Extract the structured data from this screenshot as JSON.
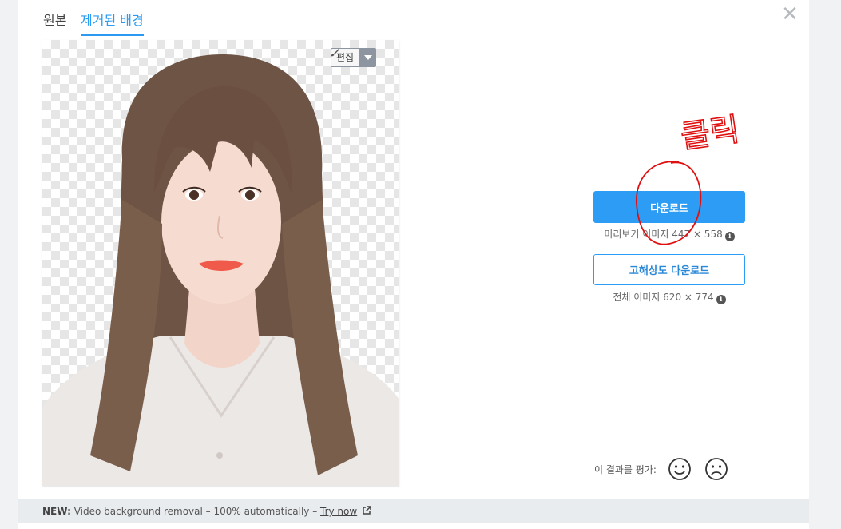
{
  "tabs": [
    {
      "label": "원본",
      "active": false
    },
    {
      "label": "제거된 배경",
      "active": true
    }
  ],
  "close_icon": "close-x-icon",
  "preview": {
    "edit_label": "편집",
    "edit_icon": "brush-icon",
    "caret_icon": "caret-down-icon"
  },
  "download": {
    "label": "다운로드",
    "info_prefix": "미리보기 이미지",
    "info_size": "447 × 558"
  },
  "hd_download": {
    "label": "고해상도 다운로드",
    "info_prefix": "전체 이미지",
    "info_size": "620 × 774"
  },
  "rating": {
    "label": "이 결과를 평가:",
    "happy_icon": "smile-icon",
    "sad_icon": "frown-icon"
  },
  "footer": {
    "new_label": "NEW:",
    "text": " Video background removal – 100% automatically – ",
    "link": "Try now"
  },
  "annotation": {
    "handwritten": "클릭"
  },
  "colors": {
    "accent": "#2d9cf5",
    "annotation": "#e01010",
    "footer_bg": "#e9ecef"
  }
}
